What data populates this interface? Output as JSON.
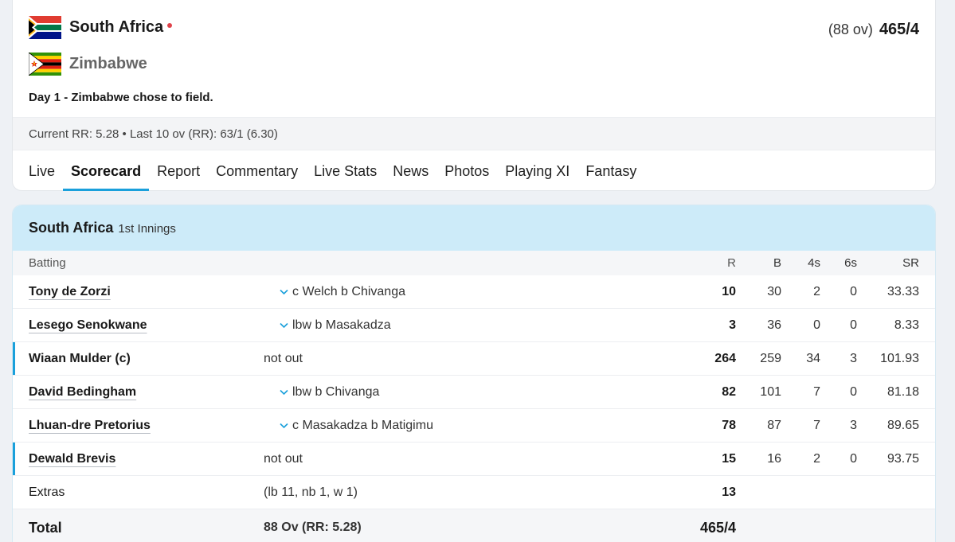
{
  "header": {
    "team1": {
      "name": "South Africa",
      "overs": "(88 ov)",
      "score": "465/4"
    },
    "team2": {
      "name": "Zimbabwe"
    },
    "status": "Day 1 - Zimbabwe chose to field.",
    "run_rate": "Current RR: 5.28  •  Last 10 ov (RR): 63/1 (6.30)"
  },
  "tabs": [
    {
      "label": "Live"
    },
    {
      "label": "Scorecard"
    },
    {
      "label": "Report"
    },
    {
      "label": "Commentary"
    },
    {
      "label": "Live Stats"
    },
    {
      "label": "News"
    },
    {
      "label": "Photos"
    },
    {
      "label": "Playing XI"
    },
    {
      "label": "Fantasy"
    }
  ],
  "innings": {
    "team": "South Africa",
    "label": "1st Innings",
    "columns": {
      "batting": "Batting",
      "r": "R",
      "b": "B",
      "fours": "4s",
      "sixes": "6s",
      "sr": "SR"
    },
    "batters": [
      {
        "name": "Tony de Zorzi",
        "dismissal": "c Welch b Chivanga",
        "r": "10",
        "b": "30",
        "fours": "2",
        "sixes": "0",
        "sr": "33.33"
      },
      {
        "name": "Lesego Senokwane",
        "dismissal": "lbw b Masakadza",
        "r": "3",
        "b": "36",
        "fours": "0",
        "sixes": "0",
        "sr": "8.33"
      },
      {
        "name": "Wiaan Mulder (c)",
        "dismissal": "not out",
        "r": "264",
        "b": "259",
        "fours": "34",
        "sixes": "3",
        "sr": "101.93"
      },
      {
        "name": "David Bedingham",
        "dismissal": "lbw b Chivanga",
        "r": "82",
        "b": "101",
        "fours": "7",
        "sixes": "0",
        "sr": "81.18"
      },
      {
        "name": "Lhuan-dre Pretorius",
        "dismissal": "c Masakadza b Matigimu",
        "r": "78",
        "b": "87",
        "fours": "7",
        "sixes": "3",
        "sr": "89.65"
      },
      {
        "name": "Dewald Brevis",
        "dismissal": "not out",
        "r": "15",
        "b": "16",
        "fours": "2",
        "sixes": "0",
        "sr": "93.75"
      }
    ],
    "extras": {
      "label": "Extras",
      "detail": "(lb 11, nb 1, w 1)",
      "value": "13"
    },
    "total": {
      "label": "Total",
      "detail": "88 Ov (RR: 5.28)",
      "value": "465/4"
    }
  },
  "colors": {
    "accent": "#1aa0db",
    "live_dot": "#e0434b",
    "innings_bg": "#cdebf9"
  }
}
